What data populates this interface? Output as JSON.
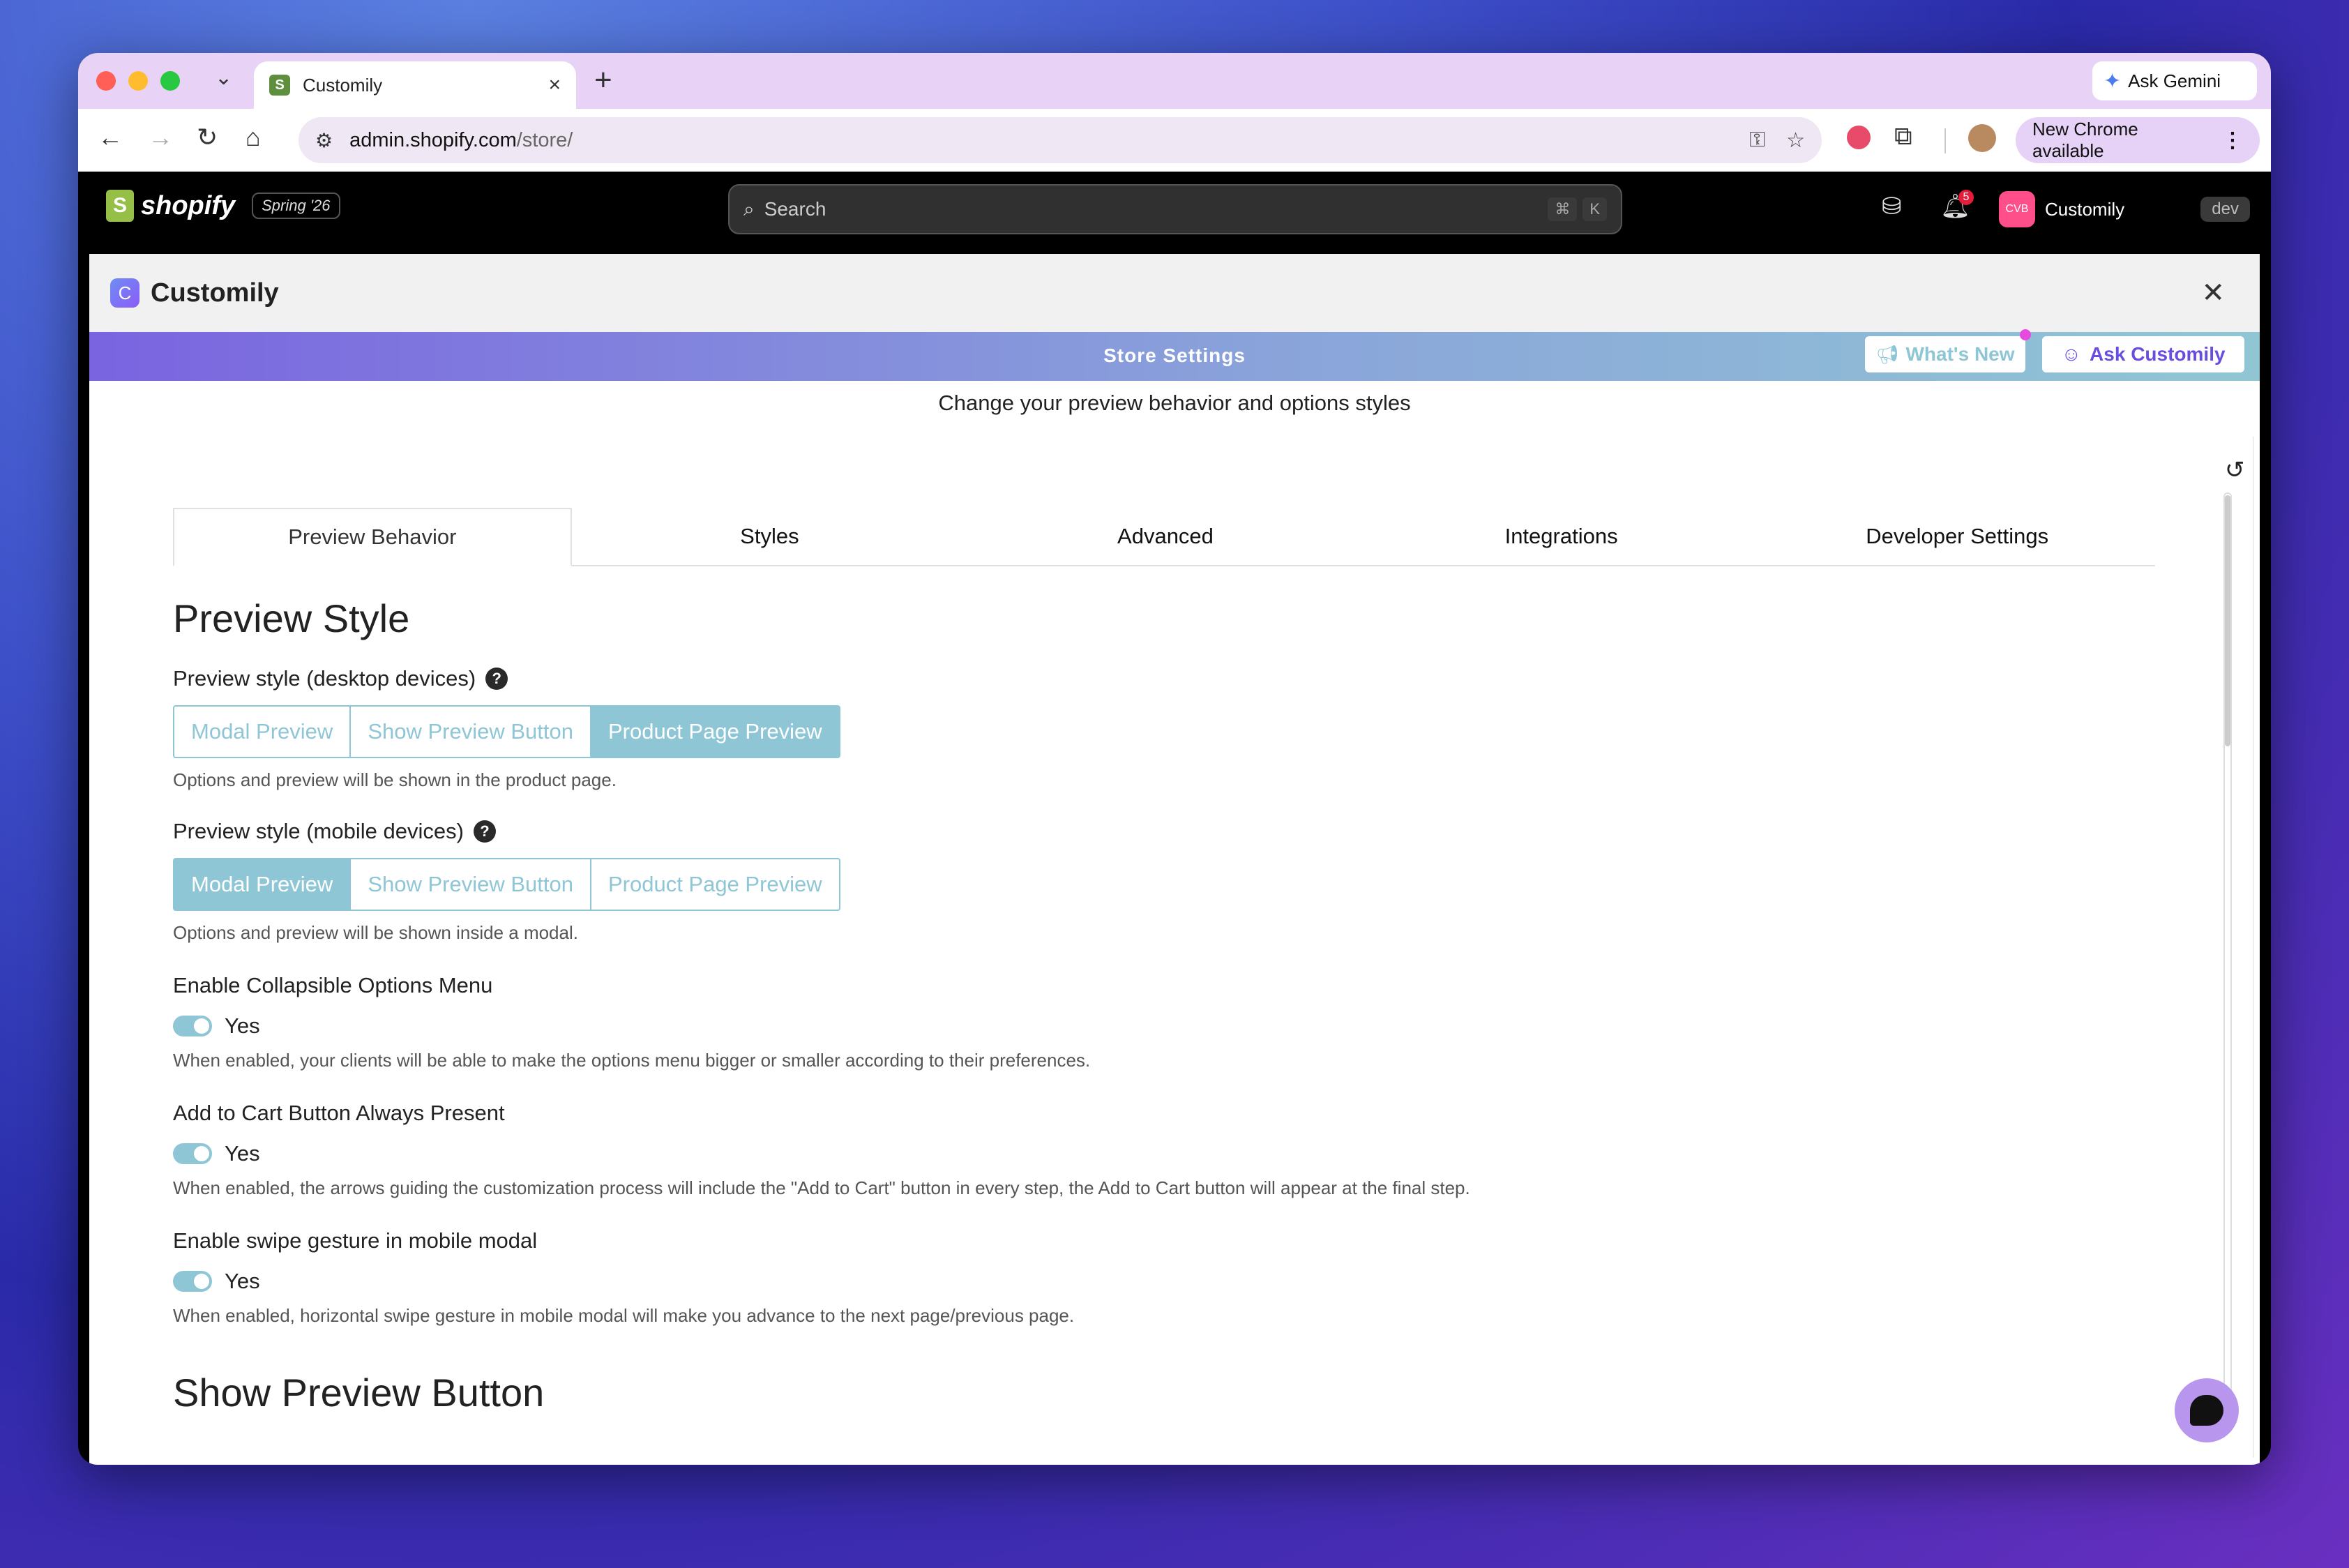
{
  "browser": {
    "tab_title": "Customily",
    "ask_gemini": "Ask Gemini",
    "url_host": "admin.shopify.com",
    "url_path": "/store/",
    "update_label": "New Chrome available"
  },
  "shopify": {
    "brand": "shopify",
    "edition_badge": "Spring '26",
    "search_placeholder": "Search",
    "shortcut_cmd": "⌘",
    "shortcut_key": "K",
    "notification_count": "5",
    "store_avatar": "CVB",
    "store_name": "Customily",
    "env_badge": "dev"
  },
  "app": {
    "title": "Customily",
    "banner_title": "Store Settings",
    "whats_new": "What's New",
    "ask": "Ask Customily",
    "subtitle": "Change your preview behavior and options styles"
  },
  "tabs": [
    {
      "label": "Preview Behavior",
      "active": true
    },
    {
      "label": "Styles",
      "active": false
    },
    {
      "label": "Advanced",
      "active": false
    },
    {
      "label": "Integrations",
      "active": false
    },
    {
      "label": "Developer Settings",
      "active": false
    }
  ],
  "preview_style": {
    "heading": "Preview Style",
    "desktop": {
      "label": "Preview style (desktop devices)",
      "options": [
        "Modal Preview",
        "Show Preview Button",
        "Product Page Preview"
      ],
      "selected": "Product Page Preview",
      "help": "Options and preview will be shown in the product page."
    },
    "mobile": {
      "label": "Preview style (mobile devices)",
      "options": [
        "Modal Preview",
        "Show Preview Button",
        "Product Page Preview"
      ],
      "selected": "Modal Preview",
      "help": "Options and preview will be shown inside a modal."
    },
    "collapsible": {
      "label": "Enable Collapsible Options Menu",
      "value": "Yes",
      "help": "When enabled, your clients will be able to make the options menu bigger or smaller according to their preferences."
    },
    "add_to_cart": {
      "label": "Add to Cart Button Always Present",
      "value": "Yes",
      "help": "When enabled, the arrows guiding the customization process will include the \"Add to Cart\" button in every step, the Add to Cart button will appear at the final step."
    },
    "swipe": {
      "label": "Enable swipe gesture in mobile modal",
      "value": "Yes",
      "help": "When enabled, horizontal swipe gesture in mobile modal will make you advance to the next page/previous page."
    }
  },
  "show_preview_button": {
    "heading": "Show Preview Button"
  },
  "colors": {
    "accent": "#8ec6d6",
    "banner_start": "#7a64e0",
    "ask_text": "#6a4de0"
  }
}
